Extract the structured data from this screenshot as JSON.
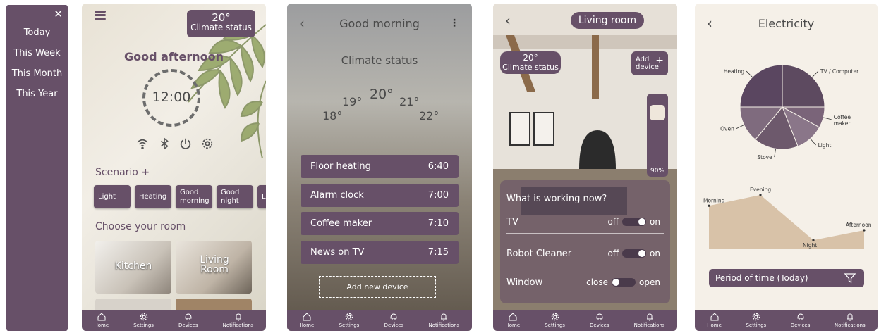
{
  "menu": {
    "items": [
      "Today",
      "This Week",
      "This Month",
      "This Year"
    ]
  },
  "nav": {
    "home": "Home",
    "settings": "Settings",
    "devices": "Devices",
    "notifications": "Notifications"
  },
  "home": {
    "temp": "20°",
    "climate": "Climate status",
    "greeting": "Good afternoon",
    "time": "12:00",
    "scenario": "Scenario",
    "scenario_add": "+",
    "chips": [
      "Light",
      "Heating",
      "Good morning",
      "Good night",
      "Le H"
    ],
    "rooms_title": "Choose your room",
    "rooms": [
      "Kitchen",
      "Living Room"
    ]
  },
  "morning": {
    "title": "Good morning",
    "climate_title": "Climate status",
    "temps": [
      "18°",
      "19°",
      "20°",
      "21°",
      "22°"
    ],
    "schedule": [
      {
        "name": "Floor heating",
        "time": "6:40"
      },
      {
        "name": "Alarm clock",
        "time": "7:00"
      },
      {
        "name": "Coffee maker",
        "time": "7:10"
      },
      {
        "name": "News on TV",
        "time": "7:15"
      }
    ],
    "add_device": "Add new device"
  },
  "living": {
    "title": "Living room",
    "temp": "20°",
    "climate": "Climate status",
    "add_device": "Add device",
    "add_plus": "+",
    "brightness": "90%",
    "panel_title": "What is working now?",
    "devices": [
      {
        "name": "TV",
        "off": "off",
        "on": "on",
        "state": "on"
      },
      {
        "name": "Robot Cleaner",
        "off": "off",
        "on": "on",
        "state": "on"
      },
      {
        "name": "Window",
        "off": "close",
        "on": "open",
        "state": "close"
      }
    ]
  },
  "electricity": {
    "title": "Electricity",
    "period": "Period of time (Today)"
  },
  "chart_data": [
    {
      "type": "pie",
      "categories": [
        "TV / Computer",
        "Coffee maker",
        "Light",
        "Stove",
        "Oven",
        "Heating"
      ],
      "values": [
        25,
        8,
        11,
        17,
        14,
        25
      ]
    },
    {
      "type": "area",
      "categories": [
        "Morning",
        "Evening",
        "Night",
        "Afternoon"
      ],
      "values": [
        48,
        60,
        10,
        21
      ],
      "ylim": [
        0,
        70
      ]
    }
  ],
  "colors": {
    "accent": "#675068",
    "panel": "#7a6479",
    "area": "#d8c2a8"
  }
}
